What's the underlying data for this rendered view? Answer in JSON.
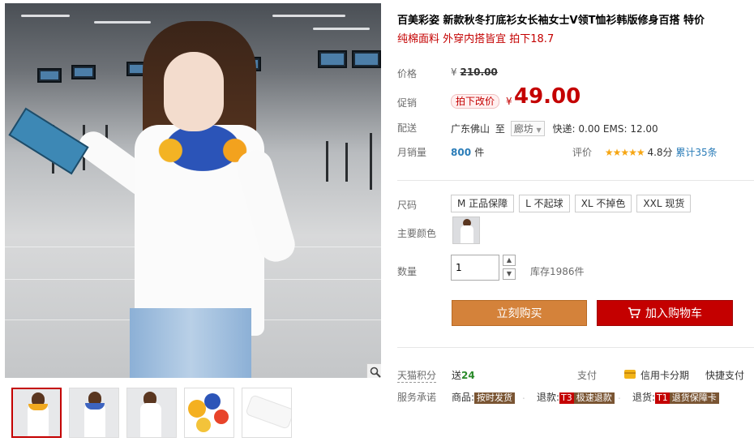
{
  "product": {
    "title": "百美彩姿 新款秋冬打底衫女长袖女士V领T恤衫韩版修身百搭 特价",
    "subtitle": "纯棉面料 外穿内搭皆宜 拍下18.7"
  },
  "price": {
    "label": "价格",
    "currency": "¥",
    "original": "210.00",
    "promo_label": "促销",
    "promo_badge": "拍下改价",
    "promo_currency": "¥",
    "promo_price": "49.00"
  },
  "shipping": {
    "label": "配送",
    "from": "广东佛山",
    "to_word": "至",
    "destination": "廊坊",
    "fees": "快递: 0.00 EMS: 12.00"
  },
  "sales": {
    "label": "月销量",
    "count": "800",
    "unit": "件",
    "rating_label": "评价",
    "stars": "★★★★★",
    "score": "4.8分",
    "reviews": "累计35条"
  },
  "sizes": {
    "label": "尺码",
    "options": [
      "M 正品保障",
      "L 不起球",
      "XL 不掉色",
      "XXL 现货"
    ]
  },
  "color": {
    "label": "主要颜色"
  },
  "quantity": {
    "label": "数量",
    "value": "1",
    "up": "▲",
    "down": "▼",
    "stock": "库存1986件"
  },
  "actions": {
    "buy_now": "立刻购买",
    "add_to_cart": "加入购物车"
  },
  "points": {
    "label": "天猫积分",
    "give_word": "送",
    "value": "24",
    "pay_label": "支付",
    "pay_credit": "信用卡分期",
    "pay_fast": "快捷支付"
  },
  "service": {
    "label": "服务承诺",
    "goods_label": "商品:",
    "goods_tag": "按时发货",
    "refund_label": "退款:",
    "refund_code": "T3",
    "refund_tag": "极速退款",
    "return_label": "退货:",
    "return_code": "T1",
    "return_tag": "退货保障卡"
  },
  "colors": {
    "accent_red": "#c40000",
    "buy_orange": "#d4823a",
    "link_blue": "#2a7cb8",
    "star_gold": "#f6a613"
  }
}
